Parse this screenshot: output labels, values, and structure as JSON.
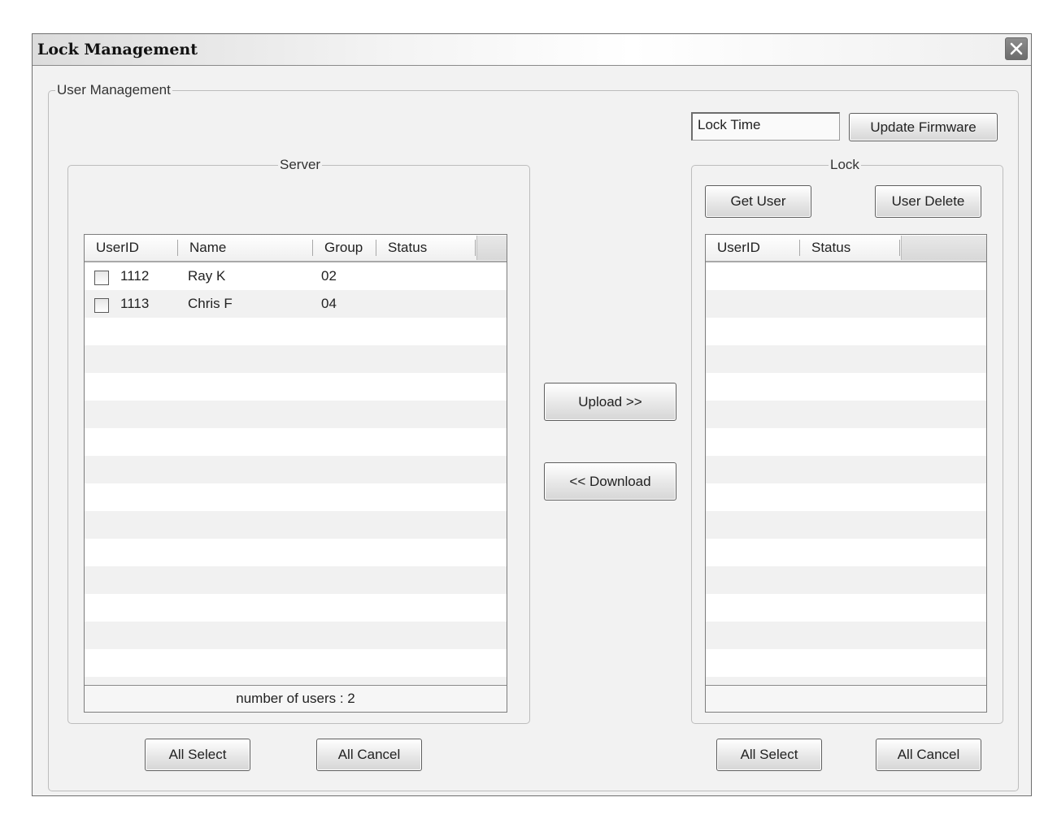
{
  "window": {
    "title": "Lock Management",
    "close_icon": "close-icon"
  },
  "user_management": {
    "legend": "User Management",
    "lock_time_value": "Lock Time",
    "update_firmware_label": "Update Firmware"
  },
  "server": {
    "legend": "Server",
    "columns": [
      "UserID",
      "Name",
      "Group",
      "Status"
    ],
    "rows": [
      {
        "user_id": "1112",
        "name": "Ray K",
        "group": "02",
        "status": ""
      },
      {
        "user_id": "1113",
        "name": "Chris F",
        "group": "04",
        "status": ""
      }
    ],
    "footer": "number of users : 2",
    "all_select_label": "All Select",
    "all_cancel_label": "All Cancel"
  },
  "transfer": {
    "upload_label": "Upload >>",
    "download_label": "<< Download"
  },
  "lock": {
    "legend": "Lock",
    "get_user_label": "Get User",
    "user_delete_label": "User Delete",
    "columns": [
      "UserID",
      "Status"
    ],
    "rows": [],
    "footer": "",
    "all_select_label": "All Select",
    "all_cancel_label": "All Cancel"
  },
  "colors": {
    "window_bg": "#f2f2f2",
    "close_button": "#7a7a7a",
    "alt_row": "#f1f1f1"
  }
}
